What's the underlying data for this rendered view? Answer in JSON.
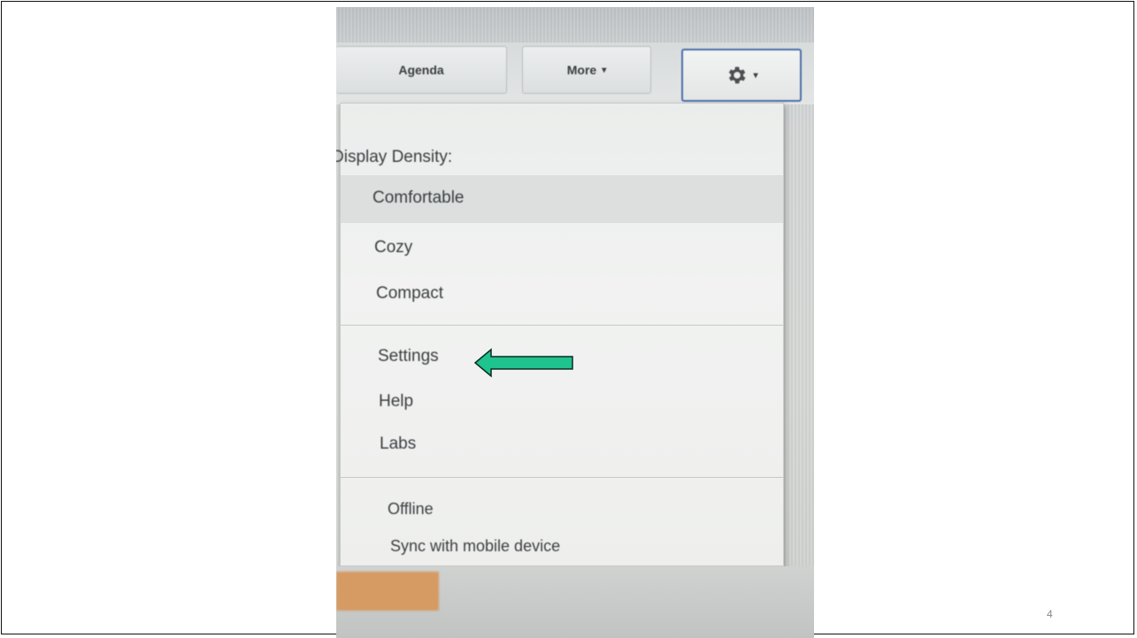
{
  "toolbar": {
    "agenda_label": "Agenda",
    "more_label": "More",
    "settings_icon": "gear-icon"
  },
  "menu": {
    "density_header": "Display Density:",
    "density_options": [
      "Comfortable",
      "Cozy",
      "Compact"
    ],
    "selected_density": "Comfortable",
    "items": [
      "Settings",
      "Help",
      "Labs"
    ],
    "offline_items": [
      "Offline",
      "Sync with mobile device"
    ]
  },
  "annotation": {
    "arrow_color": "#1fc38e",
    "arrow_target": "Settings"
  },
  "slide": {
    "page_number": "4"
  }
}
